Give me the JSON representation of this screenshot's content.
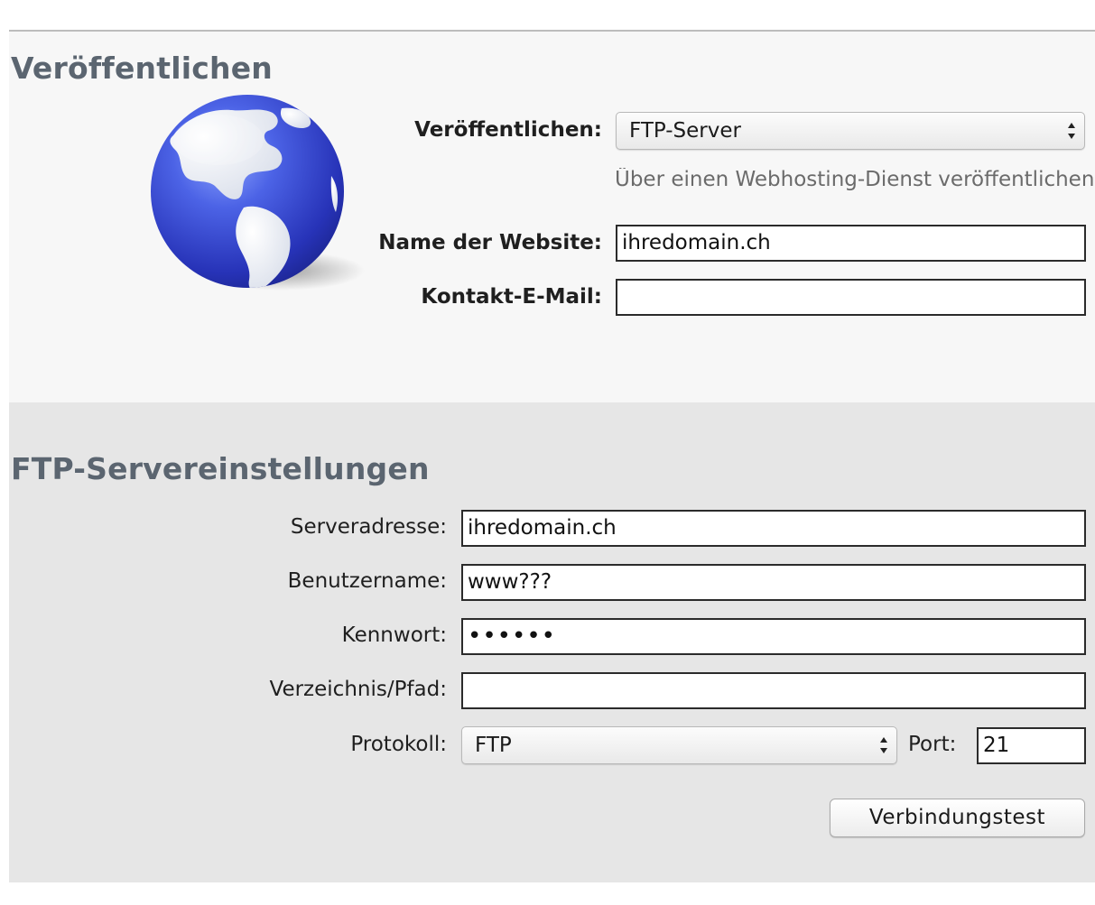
{
  "publish": {
    "title": "Veröffentlichen",
    "publish_label": "Veröffentlichen:",
    "publish_value": "FTP-Server",
    "hint": "Über einen Webhosting-Dienst veröffentlichen",
    "site_name_label": "Name der Website:",
    "site_name_value": "ihredomain.ch",
    "contact_label": "Kontakt-E-Mail:",
    "contact_value": ""
  },
  "ftp": {
    "title": "FTP-Servereinstellungen",
    "server_label": "Serveradresse:",
    "server_value": "ihredomain.ch",
    "user_label": "Benutzername:",
    "user_value": "www???",
    "password_label": "Kennwort:",
    "password_value": "••••••",
    "path_label": "Verzeichnis/Pfad:",
    "path_value": "",
    "protocol_label": "Protokoll:",
    "protocol_value": "FTP",
    "port_label": "Port:",
    "port_value": "21",
    "test_button": "Verbindungstest"
  },
  "icons": {
    "globe": "globe-icon",
    "select_arrows": "up-down-arrows-icon"
  }
}
